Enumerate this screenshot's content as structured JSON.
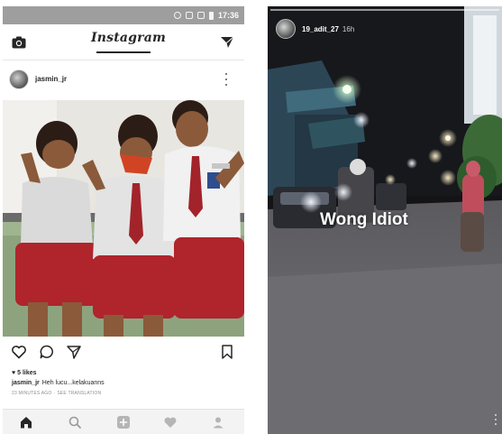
{
  "status_bar": {
    "time": "17:36"
  },
  "feed": {
    "app_name": "Instagram",
    "post": {
      "username": "jasmin_jr",
      "likes": "5 likes",
      "caption_user": "jasmin_jr",
      "caption_text": "Heh lucu...kelakuanns",
      "time_ago": "23 MINUTES AGO",
      "translation_label": "SEE TRANSLATION"
    },
    "icons": {
      "camera": "camera-icon",
      "direct": "direct-message-icon",
      "more": "more-options-icon",
      "tag": "tagged-user-icon",
      "like": "heart-icon",
      "comment": "comment-icon",
      "share": "share-icon",
      "save": "bookmark-icon"
    },
    "nav": [
      "home-icon",
      "search-icon",
      "add-post-icon",
      "activity-heart-icon",
      "profile-icon"
    ]
  },
  "story": {
    "username": "19_adit_27",
    "time_ago": "16h",
    "caption": "Wong Idiot"
  },
  "colors": {
    "status_bar": "#9e9e9e",
    "text_dark": "#262626",
    "text_muted": "#8e8e8e",
    "story_bg": "#1a1a1c"
  }
}
